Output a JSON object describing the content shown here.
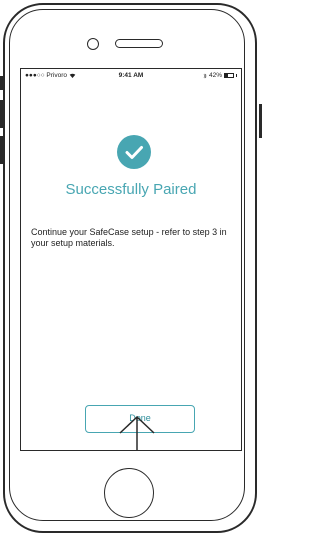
{
  "status_bar": {
    "carrier": "●●●○○ Privoro",
    "wifi_icon": "wifi-icon",
    "time": "9:41 AM",
    "bluetooth_icon": "bluetooth-icon",
    "battery_percent": "42%",
    "battery_level": 0.42
  },
  "content": {
    "success_icon": "checkmark-icon",
    "title": "Successfully Paired",
    "message": "Continue your SafeCase setup - refer to step 3 in your setup materials."
  },
  "actions": {
    "done_label": "Done"
  },
  "annotation": {
    "arrow_icon": "arrow-up-icon"
  },
  "colors": {
    "accent": "#48a6b2"
  }
}
